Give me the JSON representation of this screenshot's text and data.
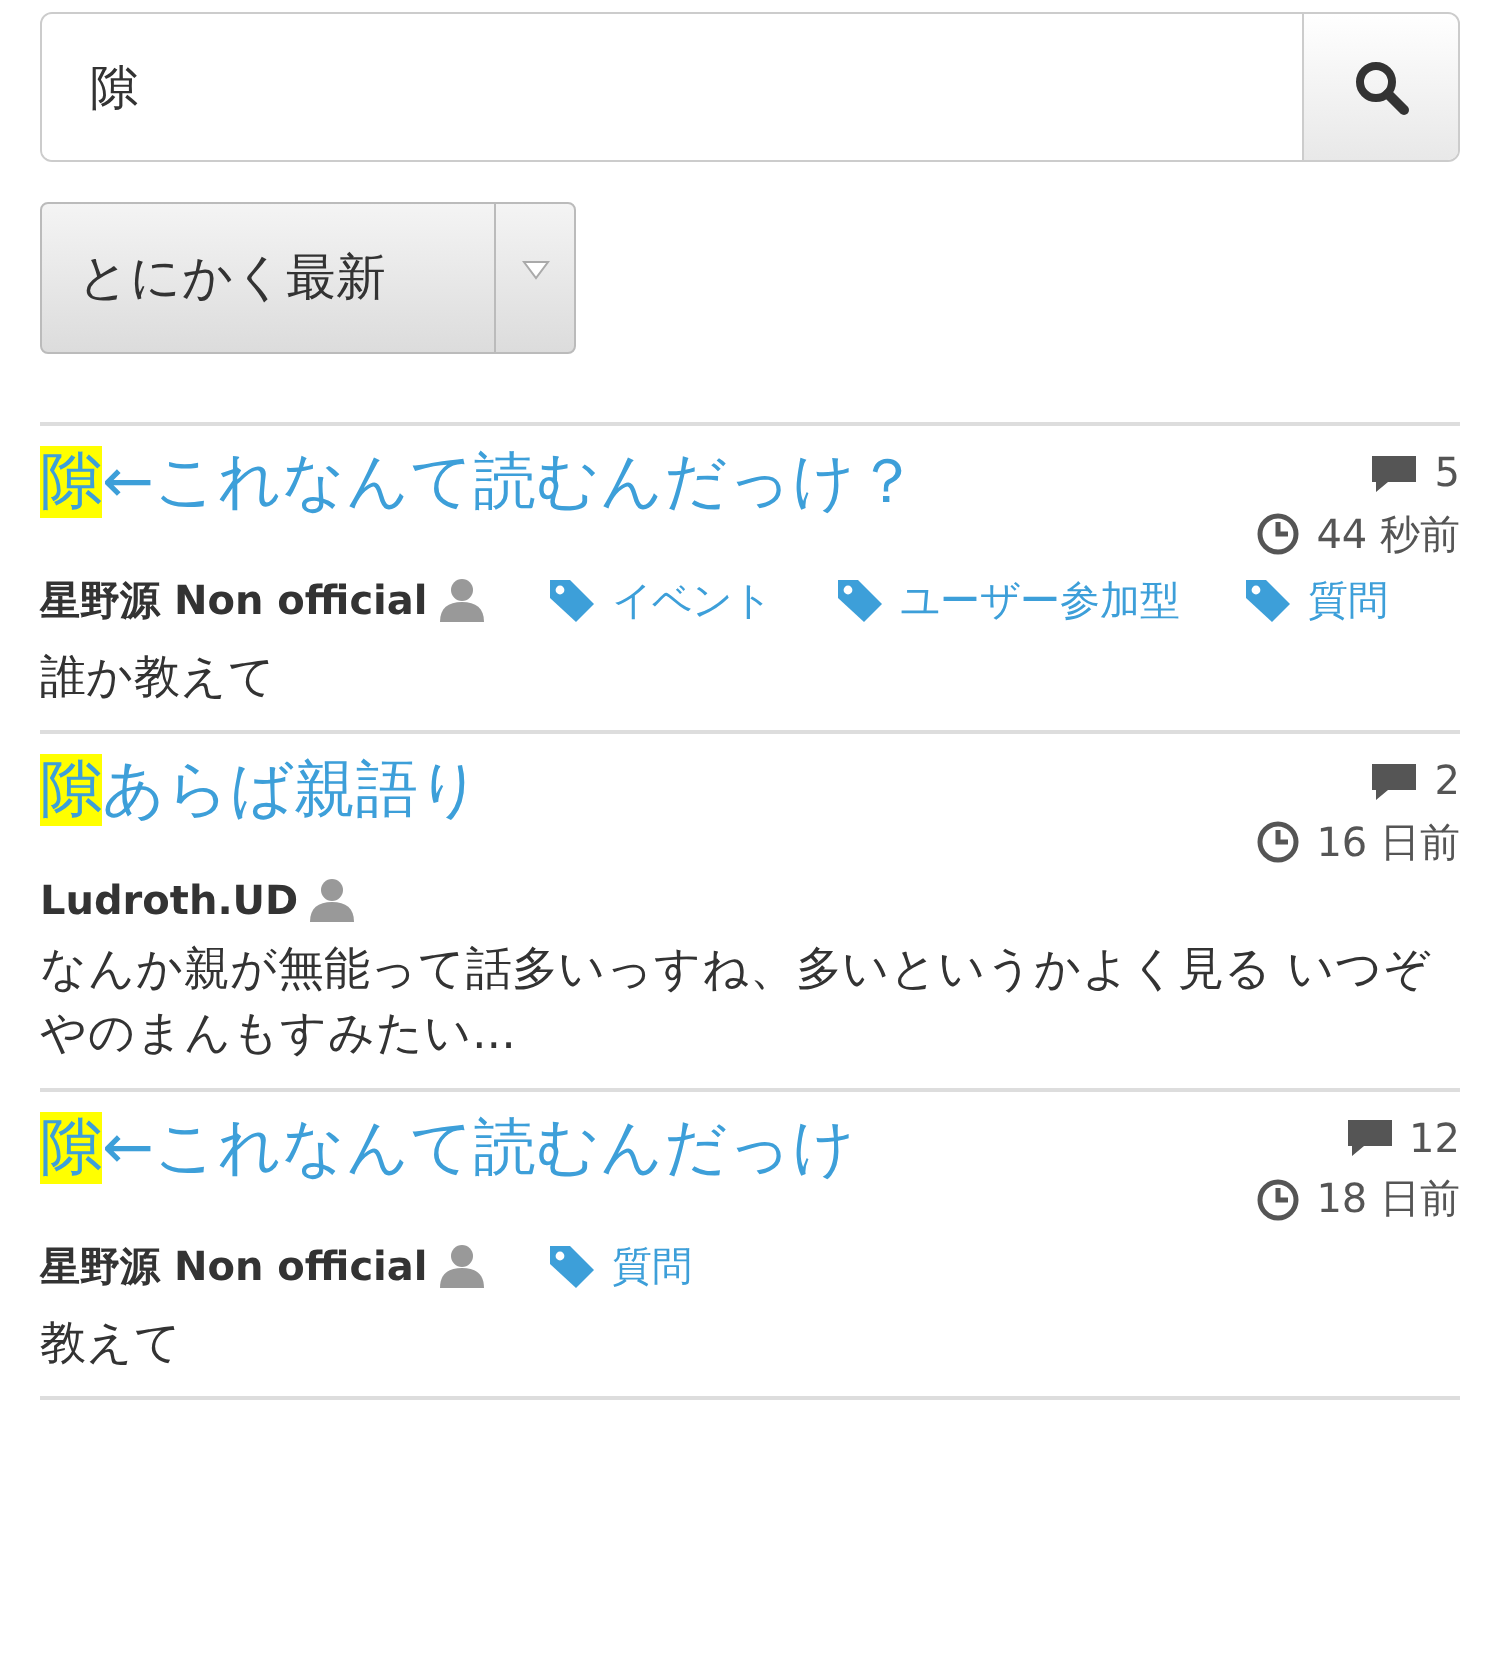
{
  "search": {
    "value": "隙"
  },
  "sort_select": {
    "label": "とにかく最新"
  },
  "posts": [
    {
      "title_parts": [
        {
          "text": "隙",
          "highlighted": true
        },
        {
          "text": "←これなんて読むんだっけ？",
          "highlighted": false
        }
      ],
      "comments": "5",
      "time": "44 秒前",
      "author": "星野源 Non official",
      "tags": [
        "イベント",
        "ユーザー参加型",
        "質問"
      ],
      "excerpt": "誰か教えて"
    },
    {
      "title_parts": [
        {
          "text": "隙",
          "highlighted": true
        },
        {
          "text": "あらば親語り",
          "highlighted": false
        }
      ],
      "comments": "2",
      "time": "16 日前",
      "author": "Ludroth.UD",
      "excerpt": "なんか親が無能って話多いっすね、多いというかよく見る いつぞやのまんもすみたい..."
    },
    {
      "title_parts": [
        {
          "text": "隙",
          "highlighted": true
        },
        {
          "text": "←これなんて読むんだっけ",
          "highlighted": false
        }
      ],
      "comments": "12",
      "time": "18 日前",
      "author": "星野源 Non official",
      "tags": [
        "質問"
      ],
      "excerpt": "教えて"
    }
  ]
}
